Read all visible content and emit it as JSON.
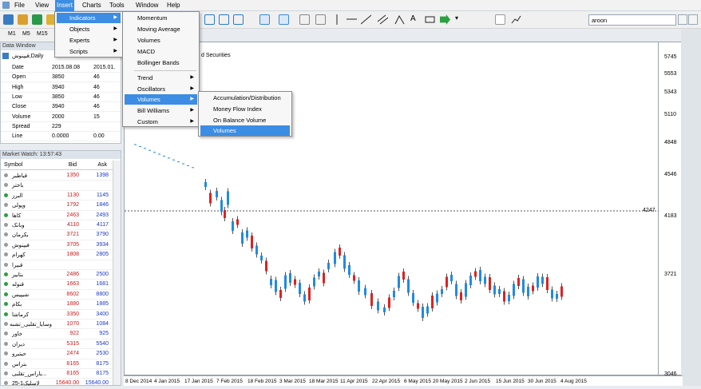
{
  "menubar": {
    "file": "File",
    "view": "View",
    "insert": "Insert",
    "charts": "Charts",
    "tools": "Tools",
    "window": "Window",
    "help": "Help"
  },
  "timeframes": [
    "M1",
    "M5",
    "M15"
  ],
  "search": {
    "value": "aroon"
  },
  "data_window": {
    "title": "Data Window",
    "symbol": "فیپنوش,Daily",
    "rows": [
      {
        "label": "Date",
        "v1": "2015.08.08",
        "v2": "2015.01."
      },
      {
        "label": "Open",
        "v1": "3850",
        "v2": "46"
      },
      {
        "label": "High",
        "v1": "3940",
        "v2": "46"
      },
      {
        "label": "Low",
        "v1": "3850",
        "v2": "46"
      },
      {
        "label": "Close",
        "v1": "3940",
        "v2": "46"
      },
      {
        "label": "Volume",
        "v1": "2000",
        "v2": "15"
      },
      {
        "label": "Spread",
        "v1": "229",
        "v2": ""
      },
      {
        "label": "Line",
        "v1": "0.0000",
        "v2": "0.00"
      }
    ]
  },
  "market_watch": {
    "title": "Market Watch: 13:57:43",
    "headers": {
      "symbol": "Symbol",
      "bid": "Bid",
      "ask": "Ask"
    },
    "rows": [
      {
        "sym": "قیاطیر",
        "bid": "1350",
        "ask": "1398",
        "s": "grey"
      },
      {
        "sym": "باختر",
        "bid": "",
        "ask": "",
        "s": "grey"
      },
      {
        "sym": "البرز",
        "bid": "1130",
        "ask": "1145",
        "s": "green"
      },
      {
        "sym": "وپولی",
        "bid": "1792",
        "ask": "1846",
        "s": "grey"
      },
      {
        "sym": "کاها",
        "bid": "2463",
        "ask": "2493",
        "s": "green"
      },
      {
        "sym": "وبانک",
        "bid": "4110",
        "ask": "4117",
        "s": "grey"
      },
      {
        "sym": "بکرمان",
        "bid": "3721",
        "ask": "3790",
        "s": "grey"
      },
      {
        "sym": "فیپنوش",
        "bid": "3705",
        "ask": "3934",
        "s": "grey"
      },
      {
        "sym": "کهرام",
        "bid": "1808",
        "ask": "2805",
        "s": "grey"
      },
      {
        "sym": "قبیرا",
        "bid": "",
        "ask": "",
        "s": "grey"
      },
      {
        "sym": "بتابیر",
        "bid": "2486",
        "ask": "2500",
        "s": "green"
      },
      {
        "sym": "قنوله",
        "bid": "1663",
        "ask": "1681",
        "s": "green"
      },
      {
        "sym": "شیپیس",
        "bid": "8602",
        "ask": "8800",
        "s": "green"
      },
      {
        "sym": "بکام",
        "bid": "1880",
        "ask": "1885",
        "s": "green"
      },
      {
        "sym": "کرماشا",
        "bid": "3350",
        "ask": "3400",
        "s": "green"
      },
      {
        "sym": "وسایا_تقلبی_تشبه",
        "bid": "1070",
        "ask": "1084",
        "s": "grey"
      },
      {
        "sym": "خاور",
        "bid": "922",
        "ask": "925",
        "s": "grey"
      },
      {
        "sym": "دیران",
        "bid": "5315",
        "ask": "5540",
        "s": "grey"
      },
      {
        "sym": "حیتیرو",
        "bid": "2474",
        "ask": "2530",
        "s": "grey"
      },
      {
        "sym": "بتراس",
        "bid": "8165",
        "ask": "8175",
        "s": "grey"
      },
      {
        "sym": "...یاراس_تقلبی",
        "bid": "8165",
        "ask": "8175",
        "s": "grey"
      },
      {
        "sym": "لاسلیک1-25",
        "bid": "15640.00",
        "ask": "15640.00",
        "s": "grey"
      }
    ]
  },
  "insert_menu": [
    "Indicators",
    "Objects",
    "Experts",
    "Scripts"
  ],
  "indicators_menu": [
    "Momentum",
    "Moving Average",
    "Volumes",
    "MACD",
    "Bollinger Bands",
    "Trend",
    "Oscillators",
    "Volumes",
    "Bill Williams",
    "Custom"
  ],
  "volumes_menu": [
    "Accumulation/Distribution",
    "Money Flow Index",
    "On Balance Volume",
    "Volumes"
  ],
  "chart": {
    "title_fragment": "d Securities",
    "current_price": "4247",
    "price_labels": [
      "5745",
      "5553",
      "5343",
      "5110",
      "4848",
      "4546",
      "4183",
      "3721",
      "3046"
    ],
    "date_labels": [
      "8 Dec 2014",
      "4 Jan 2015",
      "17 Jan 2015",
      "7 Feb 2015",
      "18 Feb 2015",
      "3 Mar 2015",
      "18 Mar 2015",
      "11 Apr 2015",
      "22 Apr 2015",
      "6 May 2015",
      "20 May 2015",
      "2 Jun 2015",
      "15 Jun 2015",
      "30 Jun 2015",
      "4 Aug 2015"
    ]
  },
  "colors": {
    "up": "#1f8be0",
    "down": "#e02020",
    "accent": "#3c8de3"
  }
}
